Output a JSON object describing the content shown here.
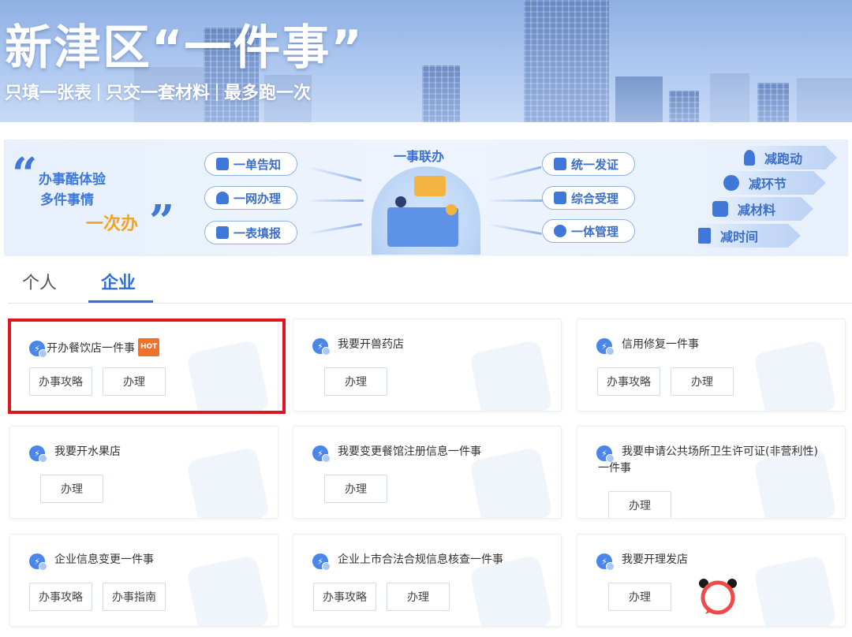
{
  "banner": {
    "title": "新津区“一件事”",
    "slogan": [
      "只填一张表",
      "只交一套材料",
      "最多跑一次"
    ]
  },
  "infographic": {
    "slogan_line1": "办事酷体验",
    "slogan_line2": "多件事情",
    "slogan_line3": "一次办",
    "center_title": "一事联办",
    "left_pills": [
      "一单告知",
      "一网办理",
      "一表填报"
    ],
    "right_pills": [
      "统一发证",
      "综合受理",
      "一体管理"
    ],
    "reductions": [
      "减跑动",
      "减环节",
      "减材料",
      "减时间"
    ],
    "colors": {
      "primary": "#3f78d8",
      "accent": "#f2a321"
    }
  },
  "tabs": {
    "personal": "个人",
    "enterprise": "企业",
    "active": "企业"
  },
  "cards": [
    {
      "title": "开办餐饮店一件事",
      "hot": "HOT",
      "buttons": [
        "办事攻略",
        "办理"
      ]
    },
    {
      "title": "我要开兽药店",
      "buttons": [
        "办理"
      ]
    },
    {
      "title": "信用修复一件事",
      "buttons": [
        "办事攻略",
        "办理"
      ]
    },
    {
      "title": "我要开水果店",
      "buttons": [
        "办理"
      ]
    },
    {
      "title": "我要变更餐馆注册信息一件事",
      "buttons": [
        "办理"
      ]
    },
    {
      "title_line1": "我要申请公共场所卫生许可证(非营利性)",
      "title_line2": "一件事",
      "buttons": [
        "办理"
      ]
    },
    {
      "title": "企业信息变更一件事",
      "buttons": [
        "办事攻略",
        "办事指南"
      ]
    },
    {
      "title": "企业上市合法合规信息核查一件事",
      "buttons": [
        "办事攻略",
        "办理"
      ]
    },
    {
      "title": "我要开理发店",
      "buttons": [
        "办理"
      ]
    }
  ],
  "highlight_color": "#e0161f"
}
